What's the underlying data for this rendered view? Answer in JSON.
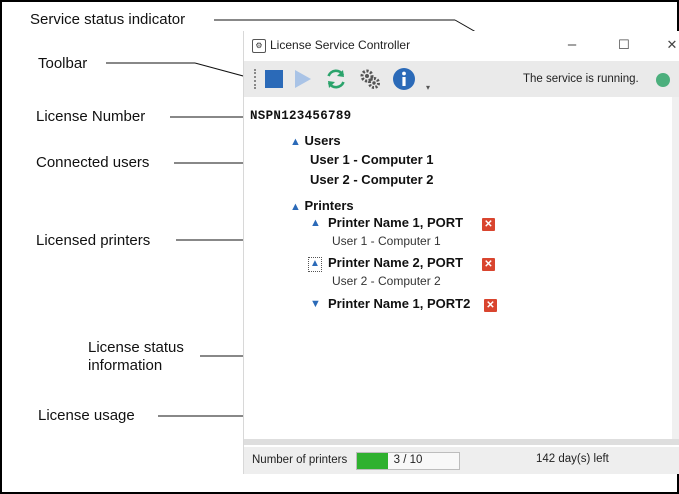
{
  "callouts": {
    "service_status": "Service status indicator",
    "toolbar": "Toolbar",
    "license_number": "License Number",
    "connected_users": "Connected users",
    "licensed_printers": "Licensed printers",
    "license_status_line1": "License status",
    "license_status_line2": "information",
    "license_usage": "License usage"
  },
  "window": {
    "title": "License Service Controller",
    "minimize_glyph": "–",
    "maximize_glyph": "☐",
    "close_glyph": "✕"
  },
  "toolbar": {
    "icons": [
      "stop-icon",
      "play-icon",
      "refresh-icon",
      "settings-icon",
      "info-icon"
    ],
    "status_text": "The service is running.",
    "status_color": "#4caf7d"
  },
  "content": {
    "license_number": "NSPN123456789",
    "users_header": "Users",
    "users": [
      "User 1 - Computer 1",
      "User 2 - Computer 2"
    ],
    "printers_header": "Printers",
    "printers": [
      {
        "name": "Printer Name 1, PORT",
        "user": "User 1 - Computer 1"
      },
      {
        "name": "Printer Name 2, PORT",
        "user": "User 2 - Computer 2"
      },
      {
        "name": "Printer Name 1, PORT2",
        "user": ""
      }
    ]
  },
  "statusbar": {
    "printers_label": "Number of printers",
    "usage_text": "3  /  10",
    "usage_fraction": 0.3,
    "days_left": "142 day(s) left"
  },
  "colors": {
    "accent_blue": "#2b6ab8",
    "remove_red": "#d9452f",
    "usage_green": "#2fb12f"
  }
}
